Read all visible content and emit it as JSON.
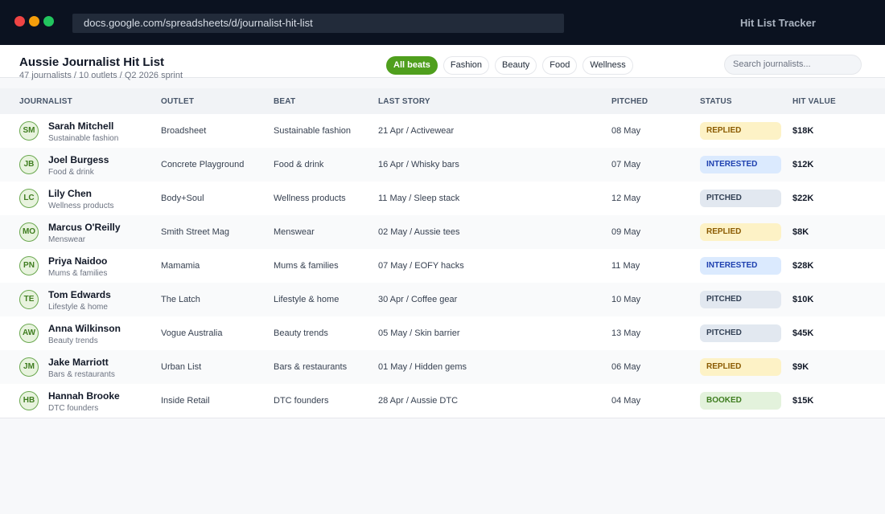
{
  "browser": {
    "url": "docs.google.com/spreadsheets/d/journalist-hit-list",
    "app_name": "Hit List Tracker"
  },
  "header": {
    "title": "Aussie Journalist Hit List",
    "subtitle": "47 journalists / 10 outlets / Q2 2026 sprint",
    "filters": [
      "All beats",
      "Fashion",
      "Beauty",
      "Food",
      "Wellness"
    ],
    "active_filter": "All beats",
    "search_placeholder": "Search journalists..."
  },
  "colors": {
    "accent": "#4f9f1d",
    "chrome": "#0b1220",
    "replied": "#fdf2c6",
    "interested": "#dbeafe",
    "pitched": "#e2e8f0",
    "booked": "#e3f2dc"
  },
  "table": {
    "columns": [
      "JOURNALIST",
      "OUTLET",
      "BEAT",
      "LAST STORY",
      "PITCHED",
      "STATUS",
      "HIT VALUE"
    ],
    "rows": [
      {
        "initials": "SM",
        "name": "Sarah Mitchell",
        "sub": "Sustainable fashion",
        "outlet": "Broadsheet",
        "beat": "Sustainable fashion",
        "last_story": "21 Apr / Activewear",
        "pitched": "08 May",
        "status": "REPLIED",
        "value": "$18K"
      },
      {
        "initials": "JB",
        "name": "Joel Burgess",
        "sub": "Food & drink",
        "outlet": "Concrete Playground",
        "beat": "Food & drink",
        "last_story": "16 Apr / Whisky bars",
        "pitched": "07 May",
        "status": "INTERESTED",
        "value": "$12K"
      },
      {
        "initials": "LC",
        "name": "Lily Chen",
        "sub": "Wellness products",
        "outlet": "Body+Soul",
        "beat": "Wellness products",
        "last_story": "11 May / Sleep stack",
        "pitched": "12 May",
        "status": "PITCHED",
        "value": "$22K"
      },
      {
        "initials": "MO",
        "name": "Marcus O'Reilly",
        "sub": "Menswear",
        "outlet": "Smith Street Mag",
        "beat": "Menswear",
        "last_story": "02 May / Aussie tees",
        "pitched": "09 May",
        "status": "REPLIED",
        "value": "$8K"
      },
      {
        "initials": "PN",
        "name": "Priya Naidoo",
        "sub": "Mums & families",
        "outlet": "Mamamia",
        "beat": "Mums & families",
        "last_story": "07 May / EOFY hacks",
        "pitched": "11 May",
        "status": "INTERESTED",
        "value": "$28K"
      },
      {
        "initials": "TE",
        "name": "Tom Edwards",
        "sub": "Lifestyle & home",
        "outlet": "The Latch",
        "beat": "Lifestyle & home",
        "last_story": "30 Apr / Coffee gear",
        "pitched": "10 May",
        "status": "PITCHED",
        "value": "$10K"
      },
      {
        "initials": "AW",
        "name": "Anna Wilkinson",
        "sub": "Beauty trends",
        "outlet": "Vogue Australia",
        "beat": "Beauty trends",
        "last_story": "05 May / Skin barrier",
        "pitched": "13 May",
        "status": "PITCHED",
        "value": "$45K"
      },
      {
        "initials": "JM",
        "name": "Jake Marriott",
        "sub": "Bars & restaurants",
        "outlet": "Urban List",
        "beat": "Bars & restaurants",
        "last_story": "01 May / Hidden gems",
        "pitched": "06 May",
        "status": "REPLIED",
        "value": "$9K"
      },
      {
        "initials": "HB",
        "name": "Hannah Brooke",
        "sub": "DTC founders",
        "outlet": "Inside Retail",
        "beat": "DTC founders",
        "last_story": "28 Apr / Aussie DTC",
        "pitched": "04 May",
        "status": "BOOKED",
        "value": "$15K"
      }
    ]
  }
}
